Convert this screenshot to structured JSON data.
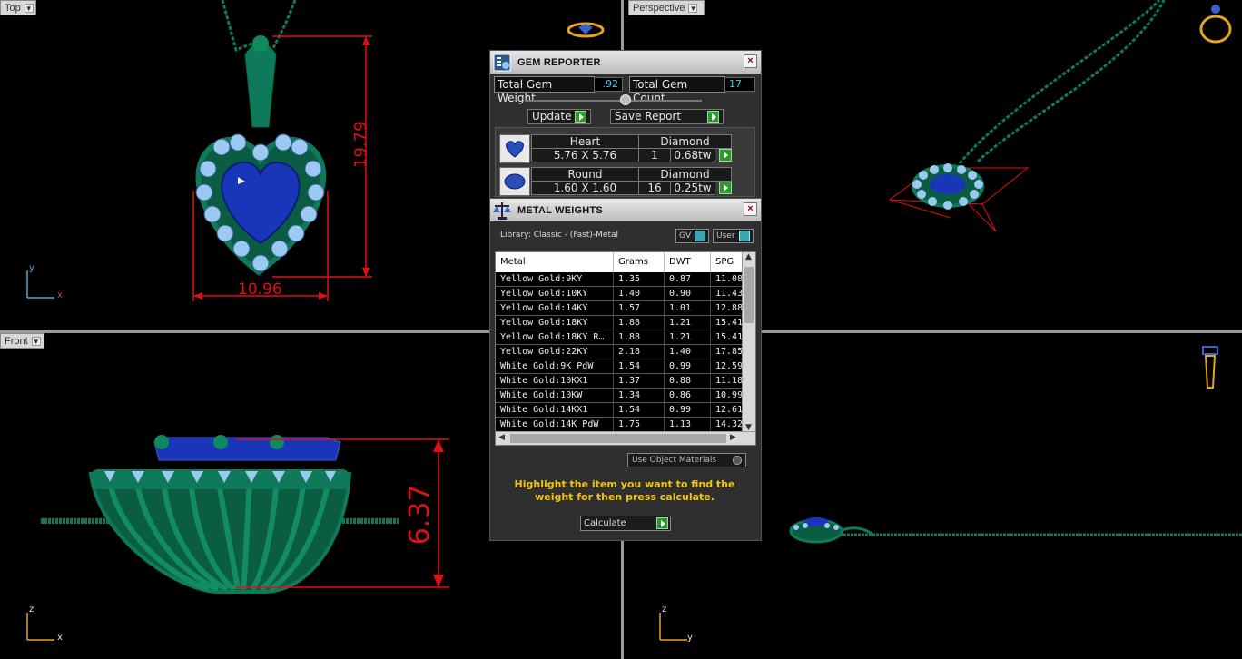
{
  "viewports": {
    "top": {
      "label": "Top",
      "dim_height": "19.79",
      "dim_width": "10.96",
      "axis_v": "y",
      "axis_h": "x"
    },
    "perspective": {
      "label": "Perspective"
    },
    "front": {
      "label": "Front",
      "dim_height": "6.37",
      "axis_v": "z",
      "axis_h": "x"
    },
    "right": {
      "axis_v": "z",
      "axis_h": "y"
    }
  },
  "gem_reporter": {
    "title": "GEM REPORTER",
    "close": "×",
    "total_weight_label": "Total Gem Weight",
    "total_weight_value": ".92",
    "total_count_label": "Total Gem Count",
    "total_count_value": "17",
    "update_label": "Update",
    "save_report_label": "Save Report",
    "gems": [
      {
        "shape": "Heart",
        "size": "5.76 X 5.76",
        "material": "Diamond",
        "count": "1",
        "weight": "0.68tw"
      },
      {
        "shape": "Round",
        "size": "1.60 X 1.60",
        "material": "Diamond",
        "count": "16",
        "weight": "0.25tw"
      }
    ]
  },
  "metal_weights": {
    "title": "METAL WEIGHTS",
    "close": "×",
    "library": "Library: Classic - (Fast)-Metal",
    "gv_label": "GV",
    "user_label": "User",
    "columns": [
      "Metal",
      "Grams",
      "DWT",
      "SPG"
    ],
    "rows": [
      [
        "Yellow Gold:9KY",
        "1.35",
        "0.87",
        "11.08"
      ],
      [
        "Yellow Gold:10KY",
        "1.40",
        "0.90",
        "11.43"
      ],
      [
        "Yellow Gold:14KY",
        "1.57",
        "1.01",
        "12.88"
      ],
      [
        "Yellow Gold:18KY",
        "1.88",
        "1.21",
        "15.41"
      ],
      [
        "Yellow Gold:18KY R…",
        "1.88",
        "1.21",
        "15.41"
      ],
      [
        "Yellow Gold:22KY",
        "2.18",
        "1.40",
        "17.85"
      ],
      [
        "White Gold:9K PdW",
        "1.54",
        "0.99",
        "12.59"
      ],
      [
        "White Gold:10KX1",
        "1.37",
        "0.88",
        "11.18"
      ],
      [
        "White Gold:10KW",
        "1.34",
        "0.86",
        "10.99"
      ],
      [
        "White Gold:14KX1",
        "1.54",
        "0.99",
        "12.61"
      ],
      [
        "White Gold:14K PdW",
        "1.75",
        "1.13",
        "14.32"
      ]
    ],
    "use_object_materials": "Use Object Materials",
    "hint": "Highlight the item you want to find the weight for then press calculate.",
    "calculate_label": "Calculate"
  },
  "colors": {
    "metal_green": "#0f7a5a",
    "gem_blue": "#1a36b8",
    "accent_diamond": "#8fc8f0",
    "dimension_red": "#e01010",
    "hint_yellow": "#f2c40e",
    "value_cyan": "#35d1e8"
  }
}
